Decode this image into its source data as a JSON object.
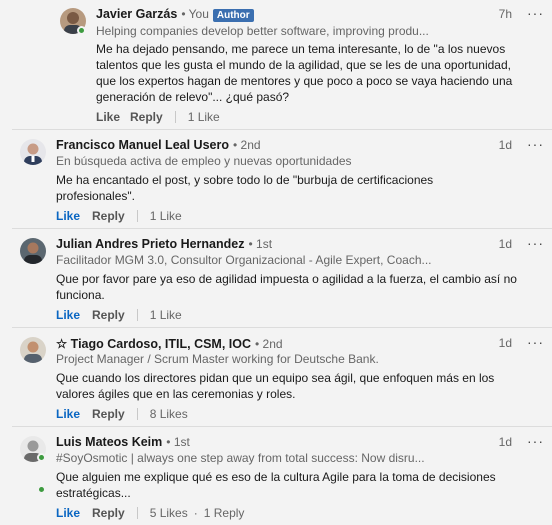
{
  "comments": [
    {
      "name": "Javier Garzás",
      "degree": "• You",
      "badge": "Author",
      "time": "7h",
      "more": "···",
      "headline": "Helping companies develop better software, improving produ...",
      "text": "Me ha dejado pensando, me parece un tema interesante, lo de \"a los nuevos talentos que les gusta el mundo de la agilidad, que se les de una oportunidad, que los expertos hagan de mentores y que poco a poco se vaya haciendo una generación de relevo\"... ¿qué pasó?",
      "like": "Like",
      "reply": "Reply",
      "likes_count": "1 Like",
      "replies_count": ""
    },
    {
      "name": "Francisco Manuel Leal Usero",
      "degree": "• 2nd",
      "badge": "",
      "time": "1d",
      "more": "···",
      "headline": "En búsqueda activa de empleo y nuevas oportunidades",
      "text": "Me ha encantado el post, y sobre todo lo de \"burbuja de certificaciones profesionales\".",
      "like": "Like",
      "reply": "Reply",
      "likes_count": "1 Like",
      "replies_count": ""
    },
    {
      "name": "Julian Andres Prieto Hernandez",
      "degree": "• 1st",
      "badge": "",
      "time": "1d",
      "more": "···",
      "headline": "Facilitador MGM 3.0, Consultor Organizacional - Agile Expert, Coach...",
      "text": "Que por favor pare ya eso de agilidad impuesta o agilidad a la fuerza, el cambio así no funciona.",
      "like": "Like",
      "reply": "Reply",
      "likes_count": "1 Like",
      "replies_count": ""
    },
    {
      "name": "☆ Tiago Cardoso, ITIL, CSM, IOC",
      "degree": "• 2nd",
      "badge": "",
      "time": "1d",
      "more": "···",
      "headline": "Project Manager / Scrum Master working for Deutsche Bank.",
      "text": "Que cuando los directores pidan que un equipo sea ágil, que enfoquen más en los valores ágiles que en las ceremonias y roles.",
      "like": "Like",
      "reply": "Reply",
      "likes_count": "8 Likes",
      "replies_count": ""
    },
    {
      "name": "Luis Mateos Keim",
      "degree": "• 1st",
      "badge": "",
      "time": "1d",
      "more": "···",
      "headline": "#SoyOsmotic | always one step away from total success: Now disru...",
      "text": "Que alguien me explique qué es eso de la cultura Agile para la toma de decisiones estratégicas...",
      "like": "Like",
      "reply": "Reply",
      "likes_count": "5 Likes",
      "replies_count": "1 Reply"
    }
  ]
}
